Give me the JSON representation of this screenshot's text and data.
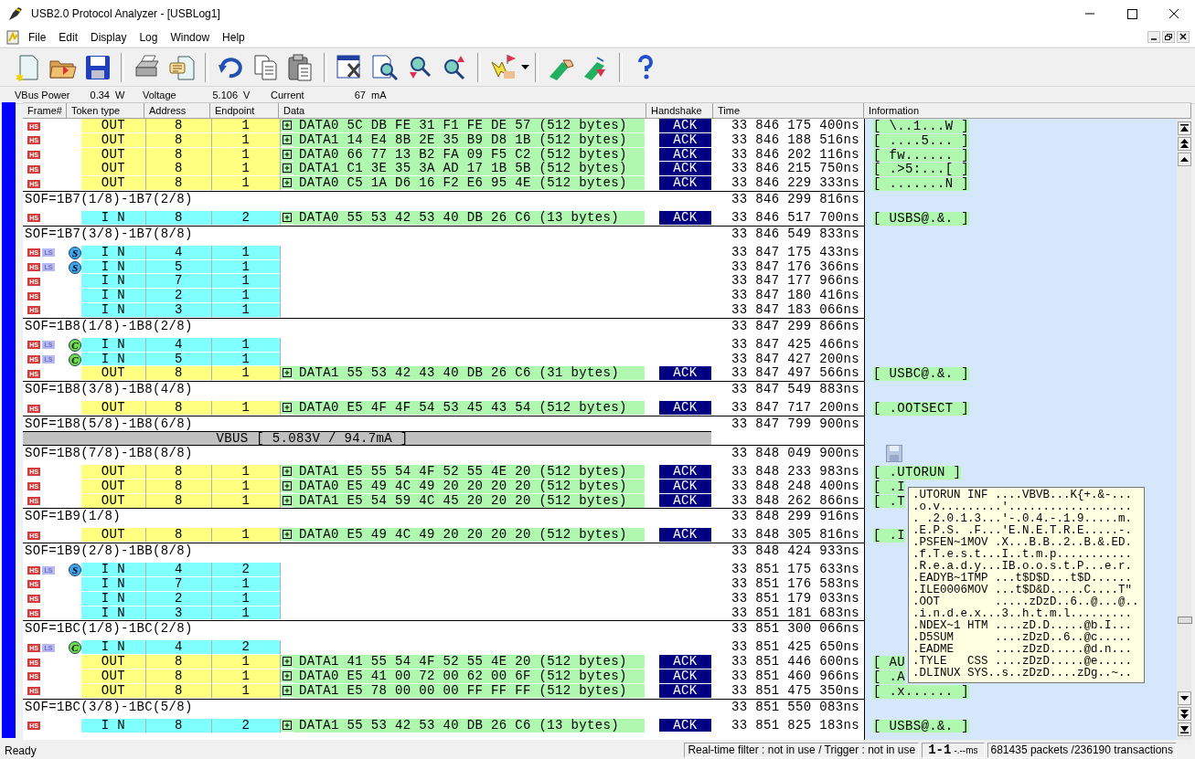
{
  "window": {
    "title": "USB2.0 Protocol Analyzer - [USBLog1]"
  },
  "menu": [
    "File",
    "Edit",
    "Display",
    "Log",
    "Window",
    "Help"
  ],
  "power": [
    {
      "label": "VBus Power",
      "value": "0.34",
      "unit": "W"
    },
    {
      "label": "Voltage",
      "value": "5.106",
      "unit": "V"
    },
    {
      "label": "Current",
      "value": "67",
      "unit": "mA"
    }
  ],
  "columns": [
    "Frame#",
    "Token type",
    "Address",
    "Endpoint",
    "Data",
    "Handshake",
    "Time",
    "Information"
  ],
  "rows": [
    {
      "kind": "out",
      "flags": [
        "HS"
      ],
      "token": "OUT",
      "address": "8",
      "endpoint": "1",
      "data": "DATA0 5C DB FE 31 F1 FE DE 57 (512 bytes)",
      "handshake": "ACK",
      "time": "33 846 175 400ns",
      "info": "[ \\..1...W ]"
    },
    {
      "kind": "out",
      "flags": [
        "HS"
      ],
      "token": "OUT",
      "address": "8",
      "endpoint": "1",
      "data": "DATA1 14 E4 8B 2E 35 B9 D8 1B (512 bytes)",
      "handshake": "ACK",
      "time": "33 846 188 516ns",
      "info": "[ ....5... ]"
    },
    {
      "kind": "out",
      "flags": [
        "HS"
      ],
      "token": "OUT",
      "address": "8",
      "endpoint": "1",
      "data": "DATA0 66 77 13 B2 FA 09 F5 C2 (512 bytes)",
      "handshake": "ACK",
      "time": "33 846 202 116ns",
      "info": "[ fw...... ]"
    },
    {
      "kind": "out",
      "flags": [
        "HS"
      ],
      "token": "OUT",
      "address": "8",
      "endpoint": "1",
      "data": "DATA1 C1 3E 35 3A AD 17 1B 5B (512 bytes)",
      "handshake": "ACK",
      "time": "33 846 215 750ns",
      "info": "[ .>5:...[ ]"
    },
    {
      "kind": "out",
      "flags": [
        "HS"
      ],
      "token": "OUT",
      "address": "8",
      "endpoint": "1",
      "data": "DATA0 C5 1A D6 16 F2 E6 95 4E (512 bytes)",
      "handshake": "ACK",
      "time": "33 846 229 333ns",
      "info": "[ .......N ]"
    },
    {
      "kind": "sof",
      "label": "SOF=1B7(1/8)-1B7(2/8)",
      "time": "33 846 299 816ns",
      "bookmark": false
    },
    {
      "kind": "in",
      "flags": [
        "HS"
      ],
      "token": "I N",
      "address": "8",
      "endpoint": "2",
      "data": "DATA0 55 53 42 53 40 DB 26 C6 (13 bytes)",
      "handshake": "ACK",
      "time": "33 846 517 700ns",
      "info": "[ USBS@.&. ]"
    },
    {
      "kind": "sof",
      "label": "SOF=1B7(3/8)-1B7(8/8)",
      "time": "33 846 549 833ns",
      "bookmark": false
    },
    {
      "kind": "in",
      "flags": [
        "HS",
        "LS"
      ],
      "marker": {
        "label": "S",
        "color": "#3ea6ee"
      },
      "token": "I N",
      "address": "4",
      "endpoint": "1",
      "time": "33 847 175 433ns"
    },
    {
      "kind": "in",
      "flags": [
        "HS",
        "LS"
      ],
      "marker": {
        "label": "S",
        "color": "#3ea6ee"
      },
      "token": "I N",
      "address": "5",
      "endpoint": "1",
      "time": "33 847 176 366ns"
    },
    {
      "kind": "in",
      "flags": [
        "HS"
      ],
      "token": "I N",
      "address": "7",
      "endpoint": "1",
      "time": "33 847 177 966ns"
    },
    {
      "kind": "in",
      "flags": [
        "HS"
      ],
      "token": "I N",
      "address": "2",
      "endpoint": "1",
      "time": "33 847 180 416ns"
    },
    {
      "kind": "in",
      "flags": [
        "HS"
      ],
      "token": "I N",
      "address": "3",
      "endpoint": "1",
      "time": "33 847 183 066ns"
    },
    {
      "kind": "sof",
      "label": "SOF=1B8(1/8)-1B8(2/8)",
      "time": "33 847 299 866ns",
      "bookmark": false
    },
    {
      "kind": "in",
      "flags": [
        "HS",
        "LS"
      ],
      "marker": {
        "label": "C",
        "color": "#6edc4c"
      },
      "token": "I N",
      "address": "4",
      "endpoint": "1",
      "time": "33 847 425 466ns"
    },
    {
      "kind": "in",
      "flags": [
        "HS",
        "LS"
      ],
      "marker": {
        "label": "C",
        "color": "#6edc4c"
      },
      "token": "I N",
      "address": "5",
      "endpoint": "1",
      "time": "33 847 427 200ns"
    },
    {
      "kind": "out",
      "flags": [
        "HS"
      ],
      "token": "OUT",
      "address": "8",
      "endpoint": "1",
      "data": "DATA1 55 53 42 43 40 DB 26 C6 (31 bytes)",
      "handshake": "ACK",
      "time": "33 847 497 566ns",
      "info": "[ USBC@.&. ]"
    },
    {
      "kind": "sof",
      "label": "SOF=1B8(3/8)-1B8(4/8)",
      "time": "33 847 549 883ns",
      "bookmark": false
    },
    {
      "kind": "out",
      "flags": [
        "HS"
      ],
      "token": "OUT",
      "address": "8",
      "endpoint": "1",
      "data": "DATA0 E5 4F 4F 54 53 45 43 54 (512 bytes)",
      "handshake": "ACK",
      "time": "33 847 717 200ns",
      "info": "[ .OOTSECT ]"
    },
    {
      "kind": "sof",
      "label": "SOF=1B8(5/8)-1B8(6/8)",
      "time": "33 847 799 900ns",
      "bookmark": false
    },
    {
      "kind": "vbus",
      "text": "VBUS [ 5.083V / 94.7mA ]"
    },
    {
      "kind": "sof",
      "label": "SOF=1B8(7/8)-1B8(8/8)",
      "time": "33 848 049 900ns",
      "bookmark": true
    },
    {
      "kind": "out",
      "flags": [
        "HS"
      ],
      "token": "OUT",
      "address": "8",
      "endpoint": "1",
      "data": "DATA1 E5 55 54 4F 52 55 4E 20 (512 bytes)",
      "handshake": "ACK",
      "time": "33 848 233 983ns",
      "info": "[ .UTORUN ]"
    },
    {
      "kind": "out",
      "flags": [
        "HS"
      ],
      "token": "OUT",
      "address": "8",
      "endpoint": "1",
      "data": "DATA0 E5 49 4C 49 20 20 20 20 (512 bytes)",
      "handshake": "ACK",
      "time": "33 848 248 400ns",
      "info": "[ .I"
    },
    {
      "kind": "out",
      "flags": [
        "HS"
      ],
      "token": "OUT",
      "address": "8",
      "endpoint": "1",
      "data": "DATA1 E5 54 59 4C 45 20 20 20 (512 bytes)",
      "handshake": "ACK",
      "time": "33 848 262 866ns",
      "info": "[ .T"
    },
    {
      "kind": "sof",
      "label": "SOF=1B9(1/8)",
      "time": "33 848 299 916ns",
      "bookmark": false
    },
    {
      "kind": "out",
      "flags": [
        "HS"
      ],
      "token": "OUT",
      "address": "8",
      "endpoint": "1",
      "data": "DATA0 E5 49 4C 49 20 20 20 20 (512 bytes)",
      "handshake": "ACK",
      "time": "33 848 305 816ns",
      "info": "[ .I"
    },
    {
      "kind": "sof",
      "label": "SOF=1B9(2/8)-1BB(8/8)",
      "time": "33 848 424 933ns",
      "bookmark": false
    },
    {
      "kind": "in",
      "flags": [
        "HS",
        "LS"
      ],
      "marker": {
        "label": "S",
        "color": "#3ea6ee"
      },
      "token": "I N",
      "address": "4",
      "endpoint": "2",
      "time": "33 851 175 633ns"
    },
    {
      "kind": "in",
      "flags": [
        "HS"
      ],
      "token": "I N",
      "address": "7",
      "endpoint": "1",
      "time": "33 851 176 583ns"
    },
    {
      "kind": "in",
      "flags": [
        "HS"
      ],
      "token": "I N",
      "address": "2",
      "endpoint": "1",
      "time": "33 851 179 033ns"
    },
    {
      "kind": "in",
      "flags": [
        "HS"
      ],
      "token": "I N",
      "address": "3",
      "endpoint": "1",
      "time": "33 851 181 683ns"
    },
    {
      "kind": "sof",
      "label": "SOF=1BC(1/8)-1BC(2/8)",
      "time": "33 851 300 066ns",
      "bookmark": false
    },
    {
      "kind": "in",
      "flags": [
        "HS",
        "LS"
      ],
      "marker": {
        "label": "C",
        "color": "#6edc4c"
      },
      "token": "I N",
      "address": "4",
      "endpoint": "2",
      "time": "33 851 425 650ns"
    },
    {
      "kind": "out",
      "flags": [
        "HS"
      ],
      "token": "OUT",
      "address": "8",
      "endpoint": "1",
      "data": "DATA1 41 55 54 4F 52 55 4E 20 (512 bytes)",
      "handshake": "ACK",
      "time": "33 851 446 600ns",
      "info": "[ AU"
    },
    {
      "kind": "out",
      "flags": [
        "HS"
      ],
      "token": "OUT",
      "address": "8",
      "endpoint": "1",
      "data": "DATA0 E5 41 00 72 00 62 00 6F (512 bytes)",
      "handshake": "ACK",
      "time": "33 851 460 966ns",
      "info": "[ .A"
    },
    {
      "kind": "out",
      "flags": [
        "HS"
      ],
      "token": "OUT",
      "address": "8",
      "endpoint": "1",
      "data": "DATA1 E5 78 00 00 00 FF FF FF (512 bytes)",
      "handshake": "ACK",
      "time": "33 851 475 350ns",
      "info": "[ .x...... ]"
    },
    {
      "kind": "sof",
      "label": "SOF=1BC(3/8)-1BC(5/8)",
      "time": "33 851 550 083ns",
      "bookmark": false
    },
    {
      "kind": "in",
      "flags": [
        "HS"
      ],
      "token": "I N",
      "address": "8",
      "endpoint": "2",
      "data": "DATA1 55 53 42 53 40 DB 26 C6 (13 bytes)",
      "handshake": "ACK",
      "time": "33 851 825 183ns",
      "info": "[ USBS@.&. ]"
    }
  ],
  "tooltip": {
    "lines": [
      ".UTORUN INF ....VBVB...K{+.&-...",
      ".o.v.........'..................",
      ". .2.0.1.3...'-.0.4.-.1.9.....m.",
      ".E.P.S. .F...'E.N.E.T.R.E.....-.",
      ".PSFEN~1MOV .X...B.B..2..B.&.ED.",
      ".f.T.e.s.t...I..t.m.p...........",
      ".R.e.a.d.y...IB.o.o.s.t.P...e.r.",
      ".EADYB~1TMP ...t$D$D...t$D......",
      ".ILE0006MOV ...t$D&D.....C....T\"",
      ".OOT        .....zDzD..6..@...@..",
      ".i.n.d.e.x...3..h.t.m.l.........",
      ".NDEX~1 HTM ....zD.D.....@b.I...",
      ".D5SUM      ....zDzD..6..@c.....",
      ".EADME      ....zDzD.....@d.n...",
      ".TYLE   CSS ....zDzD.....@e.....",
      ".DLINUX SYS..s..zDzD....zDg..~.."
    ]
  },
  "status_bar": {
    "message": "Ready",
    "filter": "Real-time filter : not in use / Trigger : not in use",
    "range": "1-1",
    "duration": "-.--ms",
    "counts": "681435 packets /236190 transactions"
  }
}
